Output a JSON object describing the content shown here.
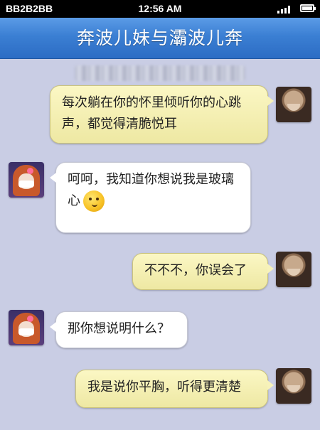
{
  "status_bar": {
    "carrier": "BB2B2BB",
    "time": "12:56 AM",
    "signal_icon": "signal-bars-icon",
    "battery_icon": "battery-icon"
  },
  "header": {
    "title": "奔波儿妹与灞波儿奔"
  },
  "timestamp": "",
  "messages": [
    {
      "side": "right",
      "sender_avatar": "monk-avatar",
      "text": "每次躺在你的怀里倾听你的心跳声，都觉得清脆悦耳"
    },
    {
      "side": "left",
      "sender_avatar": "girl-avatar",
      "text": "呵呵，我知道你想说我是玻璃心",
      "emoji": "thinking-face-icon"
    },
    {
      "side": "right",
      "sender_avatar": "monk-avatar",
      "text": "不不不，你误会了"
    },
    {
      "side": "left",
      "sender_avatar": "girl-avatar",
      "text": "那你想说明什么？"
    },
    {
      "side": "right",
      "sender_avatar": "monk-avatar",
      "text": "我是说你平胸，听得更清楚"
    }
  ],
  "colors": {
    "chat_background": "#c9cde4",
    "header_blue": "#3b7fd3",
    "outgoing_bubble": "#f5f0b5",
    "incoming_bubble": "#ffffff"
  }
}
